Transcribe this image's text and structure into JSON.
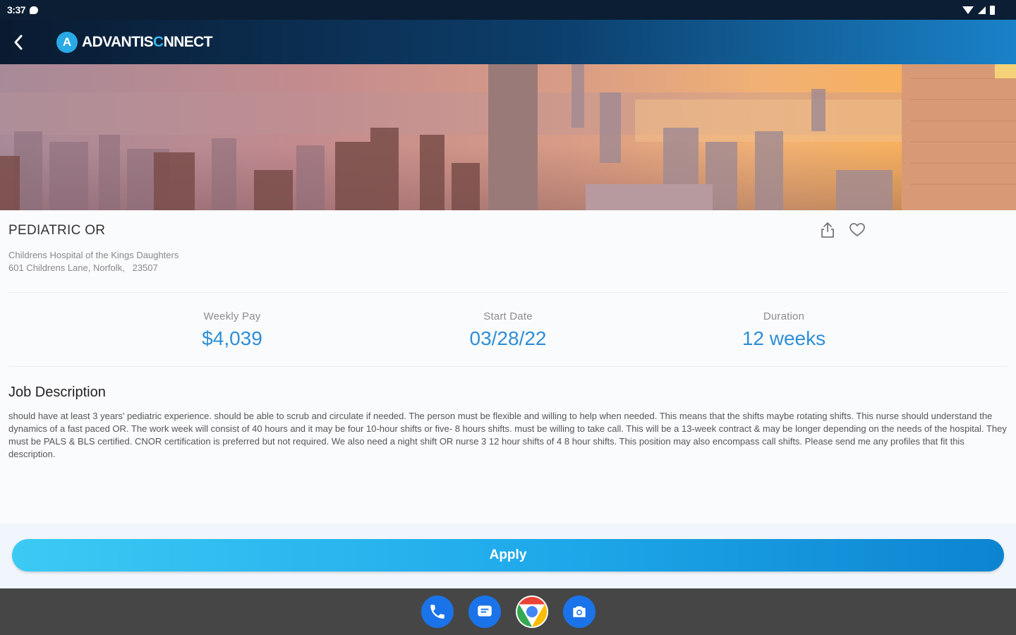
{
  "status_bar": {
    "time": "3:37"
  },
  "header": {
    "logo_mark": "A",
    "logo_part1": "ADVANTIS",
    "logo_part2": "C",
    "logo_part3": "NNECT",
    "back_icon": "chevron-left-icon"
  },
  "job": {
    "title": "PEDIATRIC OR",
    "hospital_name": "Childrens Hospital of the Kings Daughters",
    "address": "601 Childrens Lane, Norfolk,   23507"
  },
  "stats": [
    {
      "label": "Weekly Pay",
      "value": "$4,039"
    },
    {
      "label": "Start Date",
      "value": "03/28/22"
    },
    {
      "label": "Duration",
      "value": "12 weeks"
    }
  ],
  "description": {
    "title": "Job Description",
    "text": "should have at least 3 years' pediatric experience.  should be able to scrub and circulate if needed. The person must be flexible and willing to help when needed. This means that the shifts maybe rotating shifts. This nurse should understand the dynamics of a fast paced OR. The work week will consist of 40 hours and it may be four 10-hour shifts or five- 8 hours shifts. must be willing to take call. This will be a 13-week contract & may be longer depending on the needs of the hospital. They must be PALS & BLS certified. CNOR certification is preferred but not required. We also need a night shift OR nurse 3 12 hour shifts of 4 8 hour shifts. This position may also encompass call shifts. Please send me any profiles that fit this description."
  },
  "actions": {
    "apply_label": "Apply",
    "share_icon": "share-icon",
    "favorite_icon": "heart-icon"
  },
  "dock": [
    "phone-icon",
    "messages-icon",
    "chrome-icon",
    "camera-icon"
  ],
  "colors": {
    "accent": "#2e8fd6",
    "header_start": "#0a1a30",
    "header_end": "#1a82c9",
    "apply_start": "#3ccaf4",
    "apply_end": "#0d84d0",
    "nav_bar": "#464646"
  }
}
